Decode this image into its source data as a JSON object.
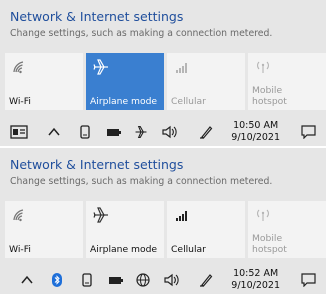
{
  "panels": [
    {
      "title": "Network & Internet settings",
      "subtitle": "Change settings, such as making a connection metered.",
      "tiles": [
        {
          "label": "Wi-Fi",
          "icon": "wifi-icon",
          "state": "off"
        },
        {
          "label": "Airplane mode",
          "icon": "airplane-icon",
          "state": "on"
        },
        {
          "label": "Cellular",
          "icon": "cellular-icon",
          "state": "disabled"
        },
        {
          "label": "Mobile\nhotspot",
          "icon": "hotspot-icon",
          "state": "disabled"
        }
      ],
      "tray_icons": [
        "news-icon",
        "chevron-up-icon",
        "phone-link-icon",
        "battery-icon",
        "airplane-icon",
        "volume-icon",
        "pen-icon"
      ],
      "clock": {
        "time": "10:50 AM",
        "date": "9/10/2021"
      }
    },
    {
      "title": "Network & Internet settings",
      "subtitle": "Change settings, such as making a connection metered.",
      "tiles": [
        {
          "label": "Wi-Fi",
          "icon": "wifi-icon",
          "state": "off"
        },
        {
          "label": "Airplane mode",
          "icon": "airplane-icon",
          "state": "off"
        },
        {
          "label": "Cellular",
          "icon": "cellular-icon",
          "state": "on"
        },
        {
          "label": "Mobile\nhotspot",
          "icon": "hotspot-icon",
          "state": "disabled"
        }
      ],
      "tray_icons": [
        "chevron-up-icon",
        "bluetooth-icon",
        "phone-link-icon",
        "battery-icon",
        "globe-icon",
        "volume-icon",
        "pen-icon"
      ],
      "clock": {
        "time": "10:52 AM",
        "date": "9/10/2021"
      }
    }
  ],
  "colors": {
    "accent": "#3a7fd0",
    "title": "#1f4e9c",
    "panel_bg": "#e6e6e6",
    "tile_bg": "#f3f3f3",
    "bluetooth": "#1e6fd9"
  }
}
